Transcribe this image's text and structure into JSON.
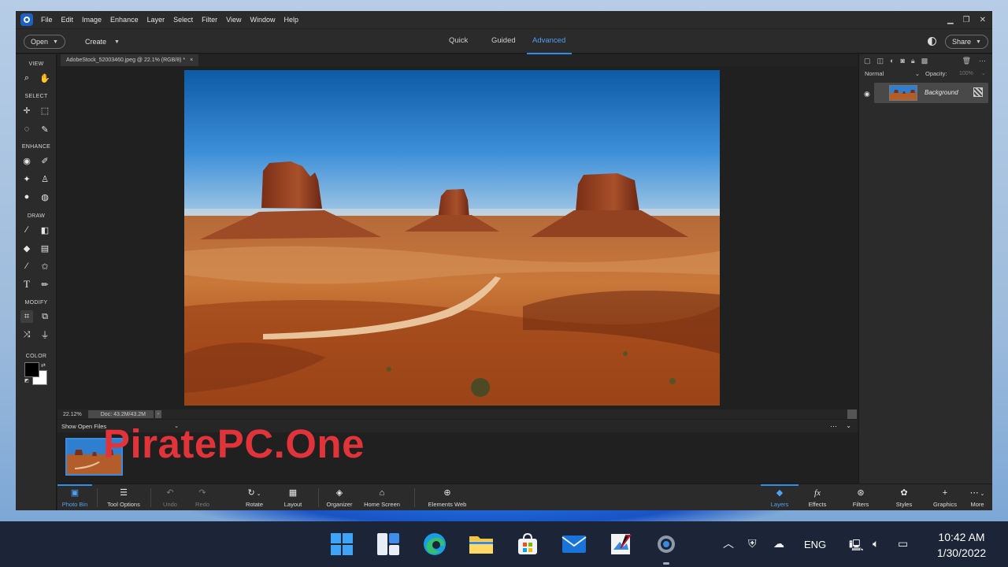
{
  "menubar": {
    "items": [
      "File",
      "Edit",
      "Image",
      "Enhance",
      "Layer",
      "Select",
      "Filter",
      "View",
      "Window",
      "Help"
    ]
  },
  "topbar": {
    "open_label": "Open",
    "create_label": "Create",
    "modes": [
      {
        "label": "Quick",
        "active": false
      },
      {
        "label": "Guided",
        "active": false
      },
      {
        "label": "Advanced",
        "active": true
      }
    ],
    "share_label": "Share"
  },
  "toolbox": {
    "sections": [
      "VIEW",
      "SELECT",
      "ENHANCE",
      "DRAW",
      "MODIFY",
      "COLOR"
    ],
    "text_tool_glyph": "T"
  },
  "document": {
    "tab_title": "AdobeStock_52003460.jpeg @ 22.1% (RGB/8) *",
    "zoom": "22.12%",
    "doc_info": "Doc: 43.2M/43.2M"
  },
  "layers_panel": {
    "blend_mode": "Normal",
    "opacity_label": "Opacity:",
    "opacity_value": "100%",
    "layers": [
      {
        "name": "Background",
        "visible": true
      }
    ]
  },
  "photo_bin": {
    "show_label": "Show Open Files"
  },
  "bottom_bar": {
    "left": [
      {
        "label": "Photo Bin",
        "icon": "photo-bin-icon",
        "glyph": "▣",
        "active": true,
        "enabled": true
      },
      {
        "label": "Tool Options",
        "icon": "tool-options-icon",
        "glyph": "☰",
        "active": false,
        "enabled": true
      },
      {
        "label": "Undo",
        "icon": "undo-icon",
        "glyph": "↶",
        "active": false,
        "enabled": false
      },
      {
        "label": "Redo",
        "icon": "redo-icon",
        "glyph": "↷",
        "active": false,
        "enabled": false
      },
      {
        "label": "Rotate",
        "icon": "rotate-icon",
        "glyph": "↻",
        "active": false,
        "enabled": true
      },
      {
        "label": "Layout",
        "icon": "layout-icon",
        "glyph": "▦",
        "active": false,
        "enabled": true
      },
      {
        "label": "Organizer",
        "icon": "organizer-icon",
        "glyph": "◈",
        "active": false,
        "enabled": true
      },
      {
        "label": "Home Screen",
        "icon": "home-icon",
        "glyph": "⌂",
        "active": false,
        "enabled": true
      },
      {
        "label": "Elements Web",
        "icon": "globe-icon",
        "glyph": "⊕",
        "active": false,
        "enabled": true
      }
    ],
    "right": [
      {
        "label": "Layers",
        "icon": "layers-icon",
        "glyph": "◆",
        "active": true
      },
      {
        "label": "Effects",
        "icon": "effects-icon",
        "glyph": "fx",
        "active": false
      },
      {
        "label": "Filters",
        "icon": "filters-icon",
        "glyph": "⊛",
        "active": false
      },
      {
        "label": "Styles",
        "icon": "styles-icon",
        "glyph": "✿",
        "active": false
      },
      {
        "label": "Graphics",
        "icon": "graphics-icon",
        "glyph": "+",
        "active": false
      },
      {
        "label": "More",
        "icon": "more-icon",
        "glyph": "⋯",
        "active": false
      }
    ]
  },
  "watermark": {
    "text": "PiratePC.One",
    "color": "#e0343a"
  },
  "taskbar": {
    "apps": [
      "start-icon",
      "widgets-icon",
      "edge-icon",
      "file-explorer-icon",
      "store-icon",
      "mail-icon",
      "photo-editor-icon",
      "settings-icon"
    ],
    "language": "ENG",
    "time": "10:42 AM",
    "date": "1/30/2022"
  },
  "colors": {
    "accent": "#2f8fe8",
    "panel": "#2b2b2b",
    "canvas": "#202020",
    "taskbar": "#1b2537"
  }
}
